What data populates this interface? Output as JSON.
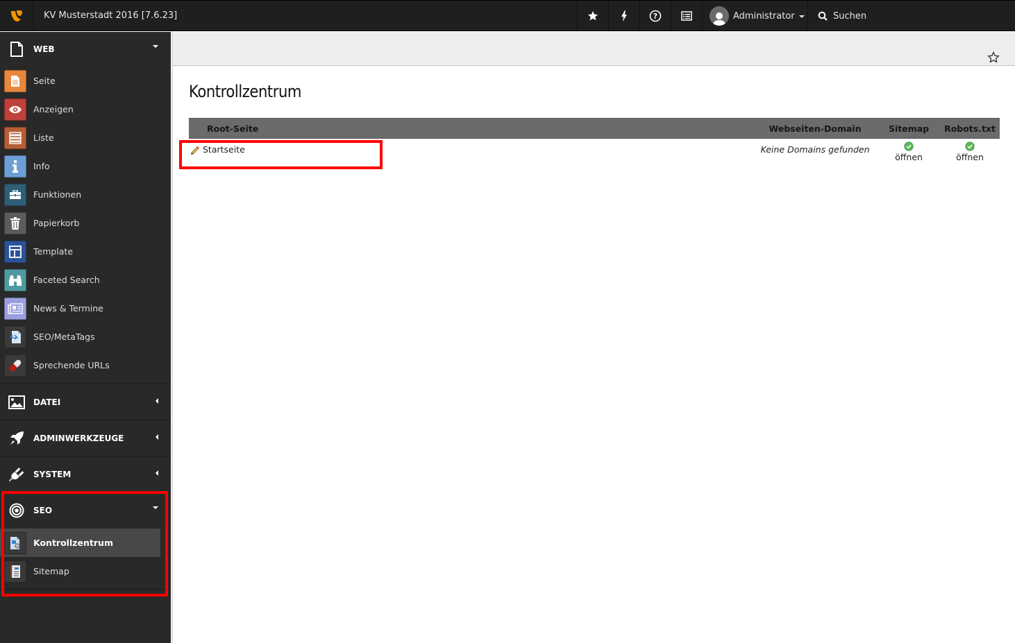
{
  "topbar": {
    "site_title": "KV Musterstadt 2016 [7.6.23]",
    "buttons": [
      {
        "icon": "star-icon",
        "label": "Bookmarks"
      },
      {
        "icon": "bolt-icon",
        "label": "Cache"
      },
      {
        "icon": "help-icon",
        "label": "Help"
      },
      {
        "icon": "system-info-icon",
        "label": "System Information"
      }
    ],
    "user": "Administrator",
    "search_label": "Suchen"
  },
  "sidebar": {
    "groups": [
      {
        "label": "WEB",
        "icon": "page-icon",
        "expanded": true,
        "items": [
          {
            "label": "Seite",
            "icon": "page-module-icon",
            "color": "#e8873e"
          },
          {
            "label": "Anzeigen",
            "icon": "eye-icon",
            "color": "#c0403c"
          },
          {
            "label": "Liste",
            "icon": "list-icon",
            "color": "#b55e35"
          },
          {
            "label": "Info",
            "icon": "info-icon",
            "color": "#6c9fd6"
          },
          {
            "label": "Funktionen",
            "icon": "toolbox-icon",
            "color": "#2f5f77"
          },
          {
            "label": "Papierkorb",
            "icon": "trash-icon",
            "color": "#5c5c5c"
          },
          {
            "label": "Template",
            "icon": "template-icon",
            "color": "#2c5397"
          },
          {
            "label": "Faceted Search",
            "icon": "binoculars-icon",
            "color": "#4f9aa0"
          },
          {
            "label": "News & Termine",
            "icon": "news-icon",
            "color": "#9b9fe0"
          },
          {
            "label": "SEO/MetaTags",
            "icon": "seo-metatags-icon",
            "color": "#3a3a3a"
          },
          {
            "label": "Sprechende URLs",
            "icon": "pill-icon",
            "color": "#3a3a3a"
          }
        ]
      },
      {
        "label": "DATEI",
        "icon": "image-icon",
        "expanded": false
      },
      {
        "label": "ADMINWERKZEUGE",
        "icon": "rocket-icon",
        "expanded": false
      },
      {
        "label": "SYSTEM",
        "icon": "plug-icon",
        "expanded": false
      },
      {
        "label": "SEO",
        "icon": "target-icon",
        "expanded": true,
        "items": [
          {
            "label": "Kontrollzentrum",
            "icon": "control-center-icon",
            "active": true
          },
          {
            "label": "Sitemap",
            "icon": "sitemap-icon",
            "active": false
          }
        ]
      }
    ]
  },
  "content": {
    "title": "Kontrollzentrum",
    "table": {
      "headers": [
        "Root-Seite",
        "Webseiten-Domain",
        "Sitemap",
        "Robots.txt"
      ],
      "rows": [
        {
          "root": "Startseite",
          "domain": "Keine Domains gefunden",
          "sitemap": "öffnen",
          "robots": "öffnen"
        }
      ]
    }
  },
  "colors": {
    "highlight": "#ff0000",
    "topbar_bg": "#1f1f1f",
    "sidebar_bg": "#292929",
    "table_header_bg": "#6b6b6b",
    "ok_green": "#5cb85c"
  }
}
